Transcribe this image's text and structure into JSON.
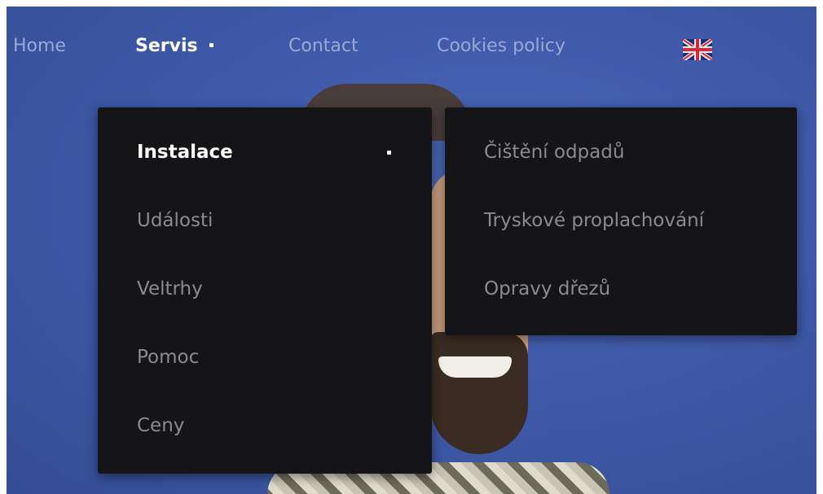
{
  "nav": {
    "items": [
      {
        "label": "Home"
      },
      {
        "label": "Servis"
      },
      {
        "label": "Contact"
      },
      {
        "label": "Cookies policy"
      }
    ],
    "active": "Servis",
    "flag_icon": "uk-flag-icon"
  },
  "dropdown": {
    "items": [
      {
        "label": "Instalace"
      },
      {
        "label": "Události"
      },
      {
        "label": "Veltrhy"
      },
      {
        "label": "Pomoc"
      },
      {
        "label": "Ceny"
      }
    ],
    "active": "Instalace"
  },
  "submenu": {
    "items": [
      {
        "label": "Čištění odpadů"
      },
      {
        "label": "Tryskové proplachování"
      },
      {
        "label": "Opravy dřezů"
      }
    ]
  },
  "colors": {
    "background": "#3f5aa9",
    "menu_bg": "#151518",
    "nav_text": "#9aa9d4",
    "active_text": "#ffffff",
    "menu_text": "#8b8b8f"
  }
}
